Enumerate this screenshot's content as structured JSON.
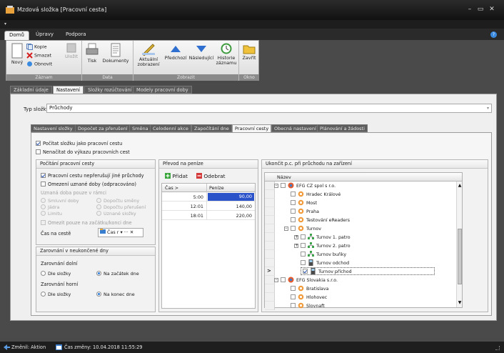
{
  "window": {
    "title": "Mzdová složka [Pracovní cesta]",
    "minimize": "–",
    "maximize": "▭",
    "close": "✕"
  },
  "qat": {
    "dropdown": "▾"
  },
  "ribbon_tabs": [
    "Domů",
    "Úpravy",
    "Podpora"
  ],
  "help": "?",
  "ribbon": {
    "groups": {
      "records": "Záznam",
      "data": "Data",
      "show": "Zobrazit",
      "window": "Okno"
    },
    "buttons": {
      "new": "Nový",
      "copy": "Kopie",
      "delete": "Smazat",
      "refresh": "Obnovit",
      "save": "Uložit",
      "print": "Tisk",
      "documents": "Dokumenty",
      "current_view": "Aktuální zobrazení",
      "previous": "Předchozí",
      "next": "Následující",
      "history": "Historie záznamu",
      "close": "Zavřít"
    }
  },
  "view_tabs": [
    "Základní údaje",
    "Nastavení",
    "Složky rozúčtování",
    "Modely pracovní doby"
  ],
  "type_label": "Typ složky",
  "type_value": "Průchody",
  "inner_tabs": [
    "Nastavení složky",
    "Dopočet za přerušení",
    "Směna",
    "Celodenní akce",
    "Započítání dne",
    "Pracovní cesty",
    "Obecná nastavení",
    "Plánování a žádosti"
  ],
  "top_checks": {
    "count_as_trip": "Počítat složku jako pracovní cestu",
    "no_load": "Nenačítat do výkazu pracovních cest"
  },
  "calc": {
    "header": "Počítání pracovní cesty",
    "chk_not_interrupt": "Pracovní cestu nepřerušují jiné průchody",
    "chk_limit": "Omezení uznané doby (odpracováno)",
    "only_in": "Uznaná doba pouze v rámci",
    "r_contract": "Smluvní doby",
    "r_shift_calc": "Dopočtu směny",
    "r_core": "Jádra",
    "r_interrupt_calc": "Dopočtu přerušení",
    "r_limit": "Limitu",
    "r_recognized": "Uznané složky",
    "chk_start_end": "Omezit pouze na začátku/konci dne",
    "time_label": "Čas na cestě",
    "time_value": "Čas r",
    "time_more": "▾ ··· ✕"
  },
  "rounding": {
    "header": "Zarovnání v neukončené dny",
    "lower": "Zarovnání dolní",
    "upper": "Zarovnání horní",
    "by_folder": "Dle složky",
    "start_day": "Na začátek dne",
    "by_folder2": "Dle složky",
    "end_day": "Na konec dne"
  },
  "money": {
    "header": "Převod na peníze",
    "add": "Přidat",
    "remove": "Odebrat",
    "col_time": "Čas >",
    "col_money": "Peníze",
    "rows": [
      [
        "5:00",
        "90,00"
      ],
      [
        "12:01",
        "140,00"
      ],
      [
        "18:01",
        "220,00"
      ]
    ]
  },
  "tree": {
    "header": "Ukončit p.c. při průchodu na zařízení",
    "col_name": "Název",
    "gutter_marker": ">",
    "nodes": [
      {
        "label": "EFG CZ spol s r.o.",
        "level": 0,
        "checked": false,
        "icon": "company"
      },
      {
        "label": "Hradec Králové",
        "level": 1,
        "checked": false,
        "icon": "site"
      },
      {
        "label": "Most",
        "level": 1,
        "checked": false,
        "icon": "site"
      },
      {
        "label": "Praha",
        "level": 1,
        "checked": false,
        "icon": "site"
      },
      {
        "label": "Testování eReaders",
        "level": 1,
        "checked": false,
        "icon": "site"
      },
      {
        "label": "Turnov",
        "level": 1,
        "checked": false,
        "icon": "site"
      },
      {
        "label": "Turnov 1. patro",
        "level": 2,
        "checked": false,
        "icon": "group"
      },
      {
        "label": "Turnov 2. patro",
        "level": 2,
        "checked": false,
        "icon": "group"
      },
      {
        "label": "Turnov buňky",
        "level": 2,
        "checked": false,
        "icon": "group"
      },
      {
        "label": "Turnov odchod",
        "level": 2,
        "checked": false,
        "icon": "device"
      },
      {
        "label": "Turnov příchod",
        "level": 2,
        "checked": true,
        "icon": "device"
      },
      {
        "label": "EFG Slovakia s.r.o.",
        "level": 0,
        "checked": false,
        "icon": "company"
      },
      {
        "label": "Bratislava",
        "level": 1,
        "checked": false,
        "icon": "site"
      },
      {
        "label": "Hlohovec",
        "level": 1,
        "checked": false,
        "icon": "site"
      },
      {
        "label": "Slovnaft",
        "level": 1,
        "checked": false,
        "icon": "site"
      }
    ]
  },
  "status": {
    "changed_by": "Změnil: Aktion",
    "changed_at": "Čas změny: 10.04.2018 11:55:29"
  },
  "colors": {
    "accent": "#3a8be0",
    "titlebar": "#1a1a1a",
    "value_highlight": "#2a52c9"
  }
}
